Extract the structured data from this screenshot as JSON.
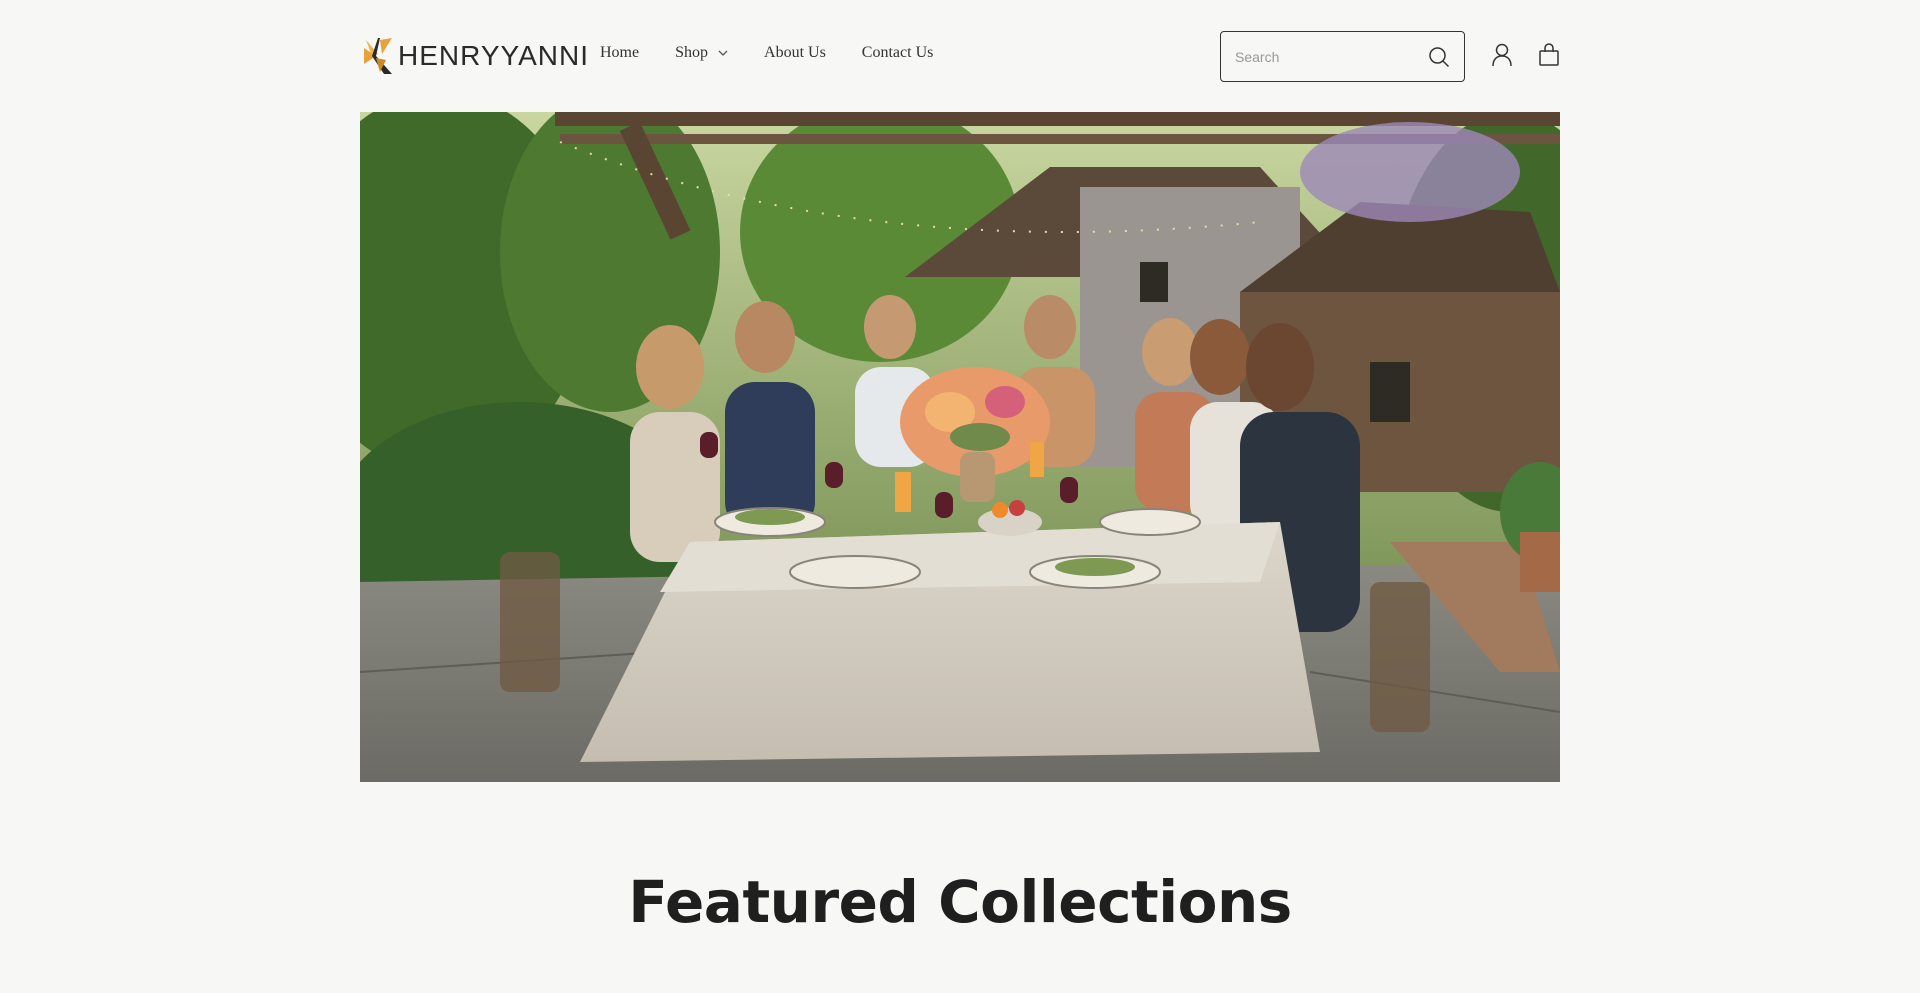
{
  "brand": {
    "name": "HENRYYANNI",
    "logo_icon": "brand-mark-icon",
    "colors": {
      "accent": "#e8a23a",
      "dark": "#2a2a2a"
    }
  },
  "nav": {
    "items": [
      {
        "label": "Home"
      },
      {
        "label": "Shop",
        "has_dropdown": true
      },
      {
        "label": "About Us"
      },
      {
        "label": "Contact Us"
      }
    ]
  },
  "search": {
    "placeholder": "Search",
    "icon": "search-icon"
  },
  "header_icons": {
    "account": "account-icon",
    "cart": "cart-icon"
  },
  "hero": {
    "image_description": "hero-image"
  },
  "featured": {
    "title": "Featured Collections"
  },
  "theme": {
    "background": "#f7f7f5",
    "text": "#222222"
  }
}
